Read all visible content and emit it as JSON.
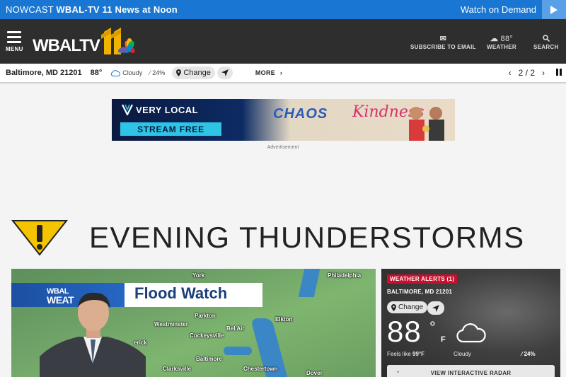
{
  "topbar": {
    "nowcast_prefix": "NOWCAST",
    "nowcast_title": "WBAL-TV 11 News at Noon",
    "watch_on_demand": "Watch on Demand"
  },
  "header": {
    "menu_label": "MENU",
    "logo_text": "WBALTV",
    "logo_number": "11",
    "subscribe_label": "SUBSCRIBE TO EMAIL",
    "weather_temp": "88°",
    "weather_label": "WEATHER",
    "search_label": "SEARCH"
  },
  "weather_strip": {
    "location": "Baltimore, MD 21201",
    "temp": "88°",
    "condition": "Cloudy",
    "rain": "24%",
    "change_label": "Change",
    "more_label": "MORE",
    "page_indicator": "2 / 2"
  },
  "ad": {
    "brand": "VERY LOCAL",
    "cta": "STREAM FREE",
    "title_part1": "CHAOS",
    "title_part2": "Kindness",
    "label": "Advertisement"
  },
  "alert": {
    "headline": "EVENING THUNDERSTORMS"
  },
  "video": {
    "logo_line1": "WBAL",
    "logo_line2": "WEAT",
    "banner": "Flood Watch",
    "towns": {
      "york": "York",
      "philadelphia": "Philadelphia",
      "parkton": "Parkton",
      "westminster": "Westminster",
      "cockeysville": "Cockeysville",
      "belair": "Bel Air",
      "elkton": "Elkton",
      "frederick": "erick",
      "baltimore": "Baltimore",
      "clarksville": "Clarksville",
      "chestertown": "Chestertown",
      "dover": "Dover"
    }
  },
  "weather_card": {
    "alerts_label": "WEATHER ALERTS (1)",
    "city": "BALTIMORE, MD 21201",
    "change_label": "Change",
    "temp": "88",
    "deg_symbol": "°",
    "unit": "F",
    "feels_prefix": "Feels like",
    "feels_value": "99°F",
    "condition": "Cloudy",
    "rain": "24%",
    "radar_label": "VIEW INTERACTIVE RADAR"
  },
  "colors": {
    "topbar": "#1976d2",
    "header": "#2e2e2e",
    "alert_red": "#c8102e",
    "warning_yellow": "#f5c400"
  }
}
